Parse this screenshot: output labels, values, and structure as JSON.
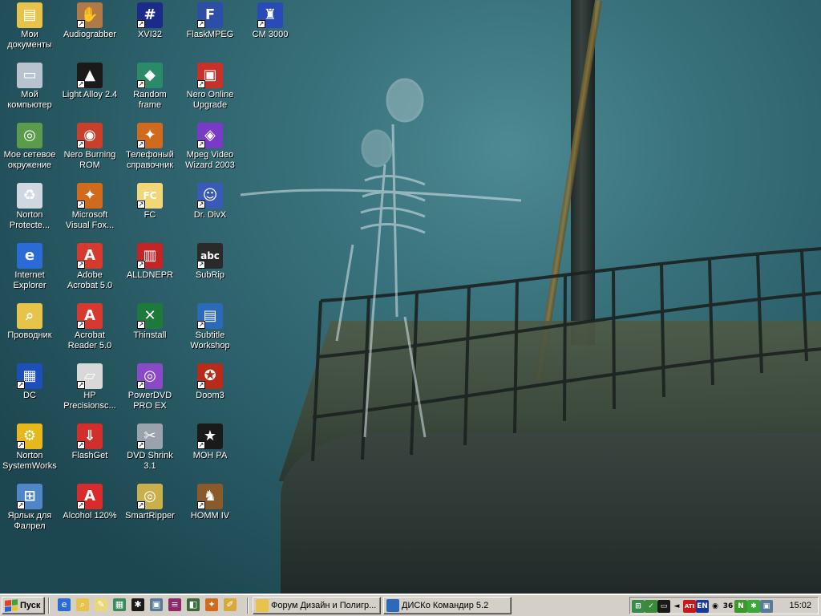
{
  "desktop": {
    "icons": [
      {
        "label": "Мои документы",
        "icon": "folder-documents-icon",
        "color": "#e8c34a",
        "glyph": "▤",
        "shortcut": false
      },
      {
        "label": "Мой компьютер",
        "icon": "computer-icon",
        "color": "#b9c3cf",
        "glyph": "▭",
        "shortcut": false
      },
      {
        "label": "Мое сетевое окружение",
        "icon": "network-places-icon",
        "color": "#5a9c4c",
        "glyph": "◎",
        "shortcut": false
      },
      {
        "label": "Norton Protecte...",
        "icon": "recycle-bin-icon",
        "color": "#cfd8e0",
        "glyph": "♻",
        "shortcut": false
      },
      {
        "label": "Internet Explorer",
        "icon": "internet-explorer-icon",
        "color": "#2b6bd6",
        "glyph": "e",
        "shortcut": false
      },
      {
        "label": "Проводник",
        "icon": "explorer-search-icon",
        "color": "#e8c34a",
        "glyph": "⌕",
        "shortcut": false
      },
      {
        "label": "DC",
        "icon": "dc-icon",
        "color": "#1d4fb8",
        "glyph": "▦",
        "shortcut": true
      },
      {
        "label": "Norton SystemWorks",
        "icon": "norton-systemworks-icon",
        "color": "#e6b81c",
        "glyph": "⚙",
        "shortcut": true
      },
      {
        "label": "Ярлык для Фалрел",
        "icon": "network-shortcut-icon",
        "color": "#4f86c9",
        "glyph": "⊞",
        "shortcut": true
      },
      {
        "label": "Audiograbber",
        "icon": "audiograbber-icon",
        "color": "#b07a48",
        "glyph": "✋",
        "shortcut": true
      },
      {
        "label": "Light Alloy 2.4",
        "icon": "light-alloy-icon",
        "color": "#1a1a1a",
        "glyph": "▲",
        "shortcut": true
      },
      {
        "label": "Nero Burning ROM",
        "icon": "nero-burning-rom-icon",
        "color": "#c8402a",
        "glyph": "◉",
        "shortcut": true
      },
      {
        "label": "Microsoft Visual Fox...",
        "icon": "visual-foxpro-icon",
        "color": "#d06a1c",
        "glyph": "✦",
        "shortcut": true
      },
      {
        "label": "Adobe Acrobat 5.0",
        "icon": "adobe-acrobat-icon",
        "color": "#d63a2e",
        "glyph": "A",
        "shortcut": true
      },
      {
        "label": "Acrobat Reader 5.0",
        "icon": "acrobat-reader-icon",
        "color": "#d63a2e",
        "glyph": "A",
        "shortcut": true
      },
      {
        "label": "HP Precisionsc...",
        "icon": "hp-scanner-icon",
        "color": "#d8d8d8",
        "glyph": "▱",
        "shortcut": true
      },
      {
        "label": "FlashGet",
        "icon": "flashget-icon",
        "color": "#d0302a",
        "glyph": "⇓",
        "shortcut": true
      },
      {
        "label": "Alcohol 120%",
        "icon": "alcohol-120-icon",
        "color": "#d82c2c",
        "glyph": "A",
        "shortcut": true
      },
      {
        "label": "XVI32",
        "icon": "xvi32-icon",
        "color": "#1c2a8a",
        "glyph": "#",
        "shortcut": true
      },
      {
        "label": "Random frame",
        "icon": "random-frame-icon",
        "color": "#2a8a6a",
        "glyph": "◆",
        "shortcut": true
      },
      {
        "label": "Телефоный справочник",
        "icon": "phonebook-icon",
        "color": "#d06a1c",
        "glyph": "✦",
        "shortcut": true
      },
      {
        "label": "FC",
        "icon": "fc-icon",
        "color": "#f0d878",
        "glyph": "FC",
        "shortcut": true
      },
      {
        "label": "ALLDNEPR",
        "icon": "alldnepr-icon",
        "color": "#c42424",
        "glyph": "▥",
        "shortcut": true
      },
      {
        "label": "Thinstall",
        "icon": "thinstall-icon",
        "color": "#1e7a3a",
        "glyph": "✕",
        "shortcut": true
      },
      {
        "label": "PowerDVD PRO EX",
        "icon": "powerdvd-icon",
        "color": "#8a4ac8",
        "glyph": "◎",
        "shortcut": true
      },
      {
        "label": "DVD Shrink 3.1",
        "icon": "dvd-shrink-icon",
        "color": "#9aa3ad",
        "glyph": "✂",
        "shortcut": true
      },
      {
        "label": "SmartRipper",
        "icon": "smartripper-icon",
        "color": "#c9b04a",
        "glyph": "◎",
        "shortcut": true
      },
      {
        "label": "FlaskMPEG",
        "icon": "flaskmpeg-icon",
        "color": "#2c4da8",
        "glyph": "F",
        "shortcut": true
      },
      {
        "label": "Nero Online Upgrade",
        "icon": "nero-online-upgrade-icon",
        "color": "#c8302a",
        "glyph": "▣",
        "shortcut": true
      },
      {
        "label": "Mpeg Video Wizard 2003",
        "icon": "mpeg-video-wizard-icon",
        "color": "#7a3ac8",
        "glyph": "◈",
        "shortcut": true
      },
      {
        "label": "Dr. DivX",
        "icon": "dr-divx-icon",
        "color": "#3a5ab8",
        "glyph": "☺",
        "shortcut": true
      },
      {
        "label": "SubRip",
        "icon": "subrip-icon",
        "color": "#2a2a2a",
        "glyph": "abc",
        "shortcut": true
      },
      {
        "label": "Subtitle Workshop",
        "icon": "subtitle-workshop-icon",
        "color": "#2a6ab8",
        "glyph": "▤",
        "shortcut": true
      },
      {
        "label": "Doom3",
        "icon": "doom3-icon",
        "color": "#b82a1a",
        "glyph": "✪",
        "shortcut": true
      },
      {
        "label": "MOH PA",
        "icon": "moh-pa-icon",
        "color": "#1a1a1a",
        "glyph": "★",
        "shortcut": true
      },
      {
        "label": "HOMM IV",
        "icon": "homm-iv-icon",
        "color": "#8a5a2a",
        "glyph": "♞",
        "shortcut": true
      },
      {
        "label": "CM 3000",
        "icon": "cm3000-icon",
        "color": "#2a4ab8",
        "glyph": "♜",
        "shortcut": true
      }
    ]
  },
  "taskbar": {
    "start_label": "Пуск",
    "quick_launch": [
      {
        "icon": "ie-quicklaunch-icon",
        "color": "#2b6bd6",
        "glyph": "e"
      },
      {
        "icon": "explorer-quicklaunch-icon",
        "color": "#e8c34a",
        "glyph": "⌕"
      },
      {
        "icon": "notepad-quicklaunch-icon",
        "color": "#e8d87a",
        "glyph": "✎"
      },
      {
        "icon": "calculator-quicklaunch-icon",
        "color": "#3a8a5a",
        "glyph": "▦"
      },
      {
        "icon": "game-quicklaunch-icon",
        "color": "#1a1a1a",
        "glyph": "✱"
      },
      {
        "icon": "media-quicklaunch-icon",
        "color": "#5a7a9a",
        "glyph": "▣"
      },
      {
        "icon": "winrar-quicklaunch-icon",
        "color": "#8a2a6a",
        "glyph": "≡"
      },
      {
        "icon": "book-quicklaunch-icon",
        "color": "#3a6a3a",
        "glyph": "◧"
      },
      {
        "icon": "fox-quicklaunch-icon",
        "color": "#d06a1c",
        "glyph": "✦"
      },
      {
        "icon": "pen-quicklaunch-icon",
        "color": "#d8a83a",
        "glyph": "✐"
      }
    ],
    "tasks": [
      {
        "label": "Форум Дизайн и Полигр...",
        "icon": "forum-window-icon",
        "color": "#e8c34a"
      },
      {
        "label": "ДИСКо Командир 5.2",
        "icon": "disco-commander-icon",
        "color": "#2a6ab8"
      }
    ],
    "tray": {
      "icons": [
        {
          "icon": "tray-network-icon",
          "color": "#3a8a4a",
          "glyph": "⊞"
        },
        {
          "icon": "tray-antivirus-icon",
          "color": "#3a8a3a",
          "glyph": "✓"
        },
        {
          "icon": "tray-monitor-icon",
          "color": "#1a1a1a",
          "glyph": "▭"
        },
        {
          "icon": "tray-volume-icon",
          "color": "#d4d0c8",
          "glyph": "◄"
        },
        {
          "icon": "tray-ati-icon",
          "color": "#c81a1a",
          "glyph": "ATI"
        },
        {
          "icon": "tray-language-icon",
          "color": "#1a3a9a",
          "glyph": "EN"
        },
        {
          "icon": "tray-media-icon",
          "color": "#d4d0c8",
          "glyph": "◉"
        },
        {
          "icon": "tray-temperature-icon",
          "color": "#d4d0c8",
          "glyph": "36"
        },
        {
          "icon": "tray-nvidia-icon",
          "color": "#3a9a2a",
          "glyph": "N"
        },
        {
          "icon": "tray-utility-icon",
          "color": "#3aa83a",
          "glyph": "✱"
        },
        {
          "icon": "tray-computer-icon",
          "color": "#5a7a9a",
          "glyph": "▣"
        }
      ],
      "clock": "15:02"
    }
  }
}
